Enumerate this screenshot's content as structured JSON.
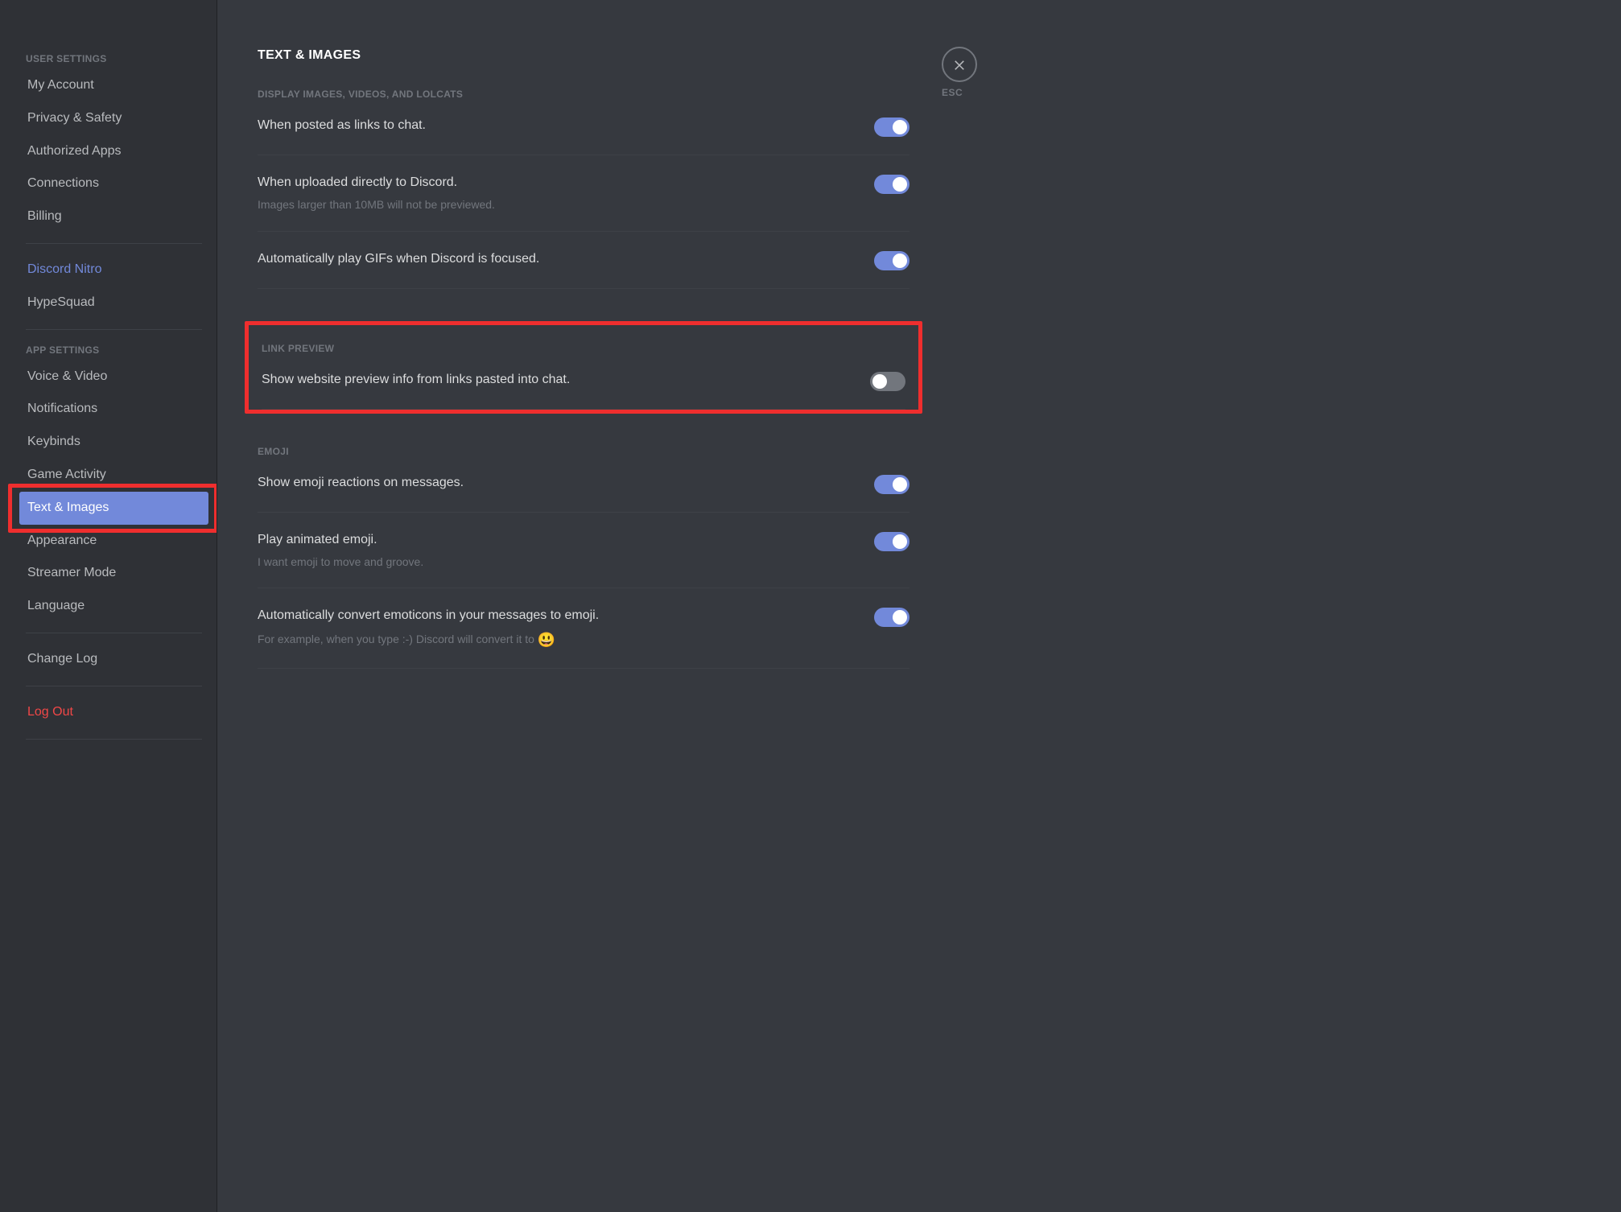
{
  "sidebar": {
    "header_user": "USER SETTINGS",
    "header_app": "APP SETTINGS",
    "items_user": [
      "My Account",
      "Privacy & Safety",
      "Authorized Apps",
      "Connections",
      "Billing"
    ],
    "items_nitro": [
      "Discord Nitro",
      "HypeSquad"
    ],
    "items_app": [
      "Voice & Video",
      "Notifications",
      "Keybinds",
      "Game Activity",
      "Text & Images",
      "Appearance",
      "Streamer Mode",
      "Language"
    ],
    "change_log": "Change Log",
    "log_out": "Log Out"
  },
  "close": {
    "label": "ESC"
  },
  "page": {
    "title": "TEXT & IMAGES",
    "sections": {
      "display": {
        "header": "DISPLAY IMAGES, VIDEOS, AND LOLCATS",
        "s1": {
          "title": "When posted as links to chat.",
          "on": true
        },
        "s2": {
          "title": "When uploaded directly to Discord.",
          "desc": "Images larger than 10MB will not be previewed.",
          "on": true
        },
        "s3": {
          "title": "Automatically play GIFs when Discord is focused.",
          "on": true
        }
      },
      "link_preview": {
        "header": "LINK PREVIEW",
        "s1": {
          "title": "Show website preview info from links pasted into chat.",
          "on": false
        }
      },
      "emoji": {
        "header": "EMOJI",
        "s1": {
          "title": "Show emoji reactions on messages.",
          "on": true
        },
        "s2": {
          "title": "Play animated emoji.",
          "desc": "I want emoji to move and groove.",
          "on": true
        },
        "s3": {
          "title": "Automatically convert emoticons in your messages to emoji.",
          "desc_pre": "For example, when you type :-) Discord will convert it to ",
          "on": true
        }
      }
    }
  }
}
